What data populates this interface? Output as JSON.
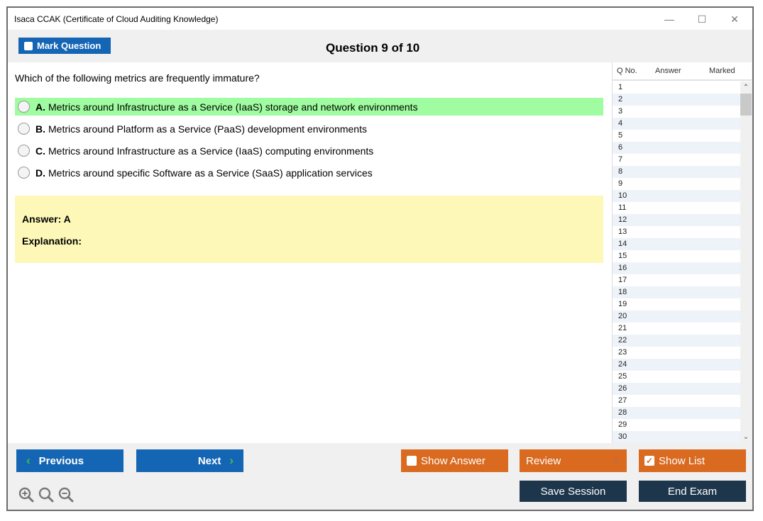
{
  "window": {
    "title": "Isaca CCAK (Certificate of Cloud Auditing Knowledge)",
    "controls": {
      "minimize": "—",
      "maximize": "☐",
      "close": "✕"
    }
  },
  "header": {
    "mark_question_label": "Mark Question",
    "mark_question_checked": false,
    "question_counter": "Question 9 of 10"
  },
  "question": {
    "text": "Which of the following metrics are frequently immature?",
    "options": [
      {
        "letter": "A.",
        "text": "Metrics around Infrastructure as a Service (IaaS) storage and network environments",
        "correct": true
      },
      {
        "letter": "B.",
        "text": "Metrics around Platform as a Service (PaaS) development environments",
        "correct": false
      },
      {
        "letter": "C.",
        "text": "Metrics around Infrastructure as a Service (IaaS) computing environments",
        "correct": false
      },
      {
        "letter": "D.",
        "text": "Metrics around specific Software as a Service (SaaS) application services",
        "correct": false
      }
    ],
    "answer_label": "Answer: A",
    "explanation_label": "Explanation:"
  },
  "question_list": {
    "headers": {
      "qno": "Q No.",
      "answer": "Answer",
      "marked": "Marked"
    },
    "rows": [
      "1",
      "2",
      "3",
      "4",
      "5",
      "6",
      "7",
      "8",
      "9",
      "10",
      "11",
      "12",
      "13",
      "14",
      "15",
      "16",
      "17",
      "18",
      "19",
      "20",
      "21",
      "22",
      "23",
      "24",
      "25",
      "26",
      "27",
      "28",
      "29",
      "30"
    ],
    "scroll_up": "^",
    "scroll_down": "v"
  },
  "footer": {
    "previous_label": "Previous",
    "next_label": "Next",
    "show_answer_label": "Show Answer",
    "show_answer_checked": false,
    "review_label": "Review",
    "show_list_label": "Show List",
    "show_list_checked": true,
    "save_session_label": "Save Session",
    "end_exam_label": "End Exam",
    "zoom_icons": [
      "zoom-in-icon",
      "zoom-reset-icon",
      "zoom-out-icon"
    ]
  },
  "colors": {
    "primary_blue": "#1565b5",
    "accent_orange": "#d96a20",
    "dark_navy": "#1d364b",
    "correct_green": "#a0fca0",
    "answer_yellow": "#fef8b8",
    "chevron_green": "#3ec43e"
  }
}
